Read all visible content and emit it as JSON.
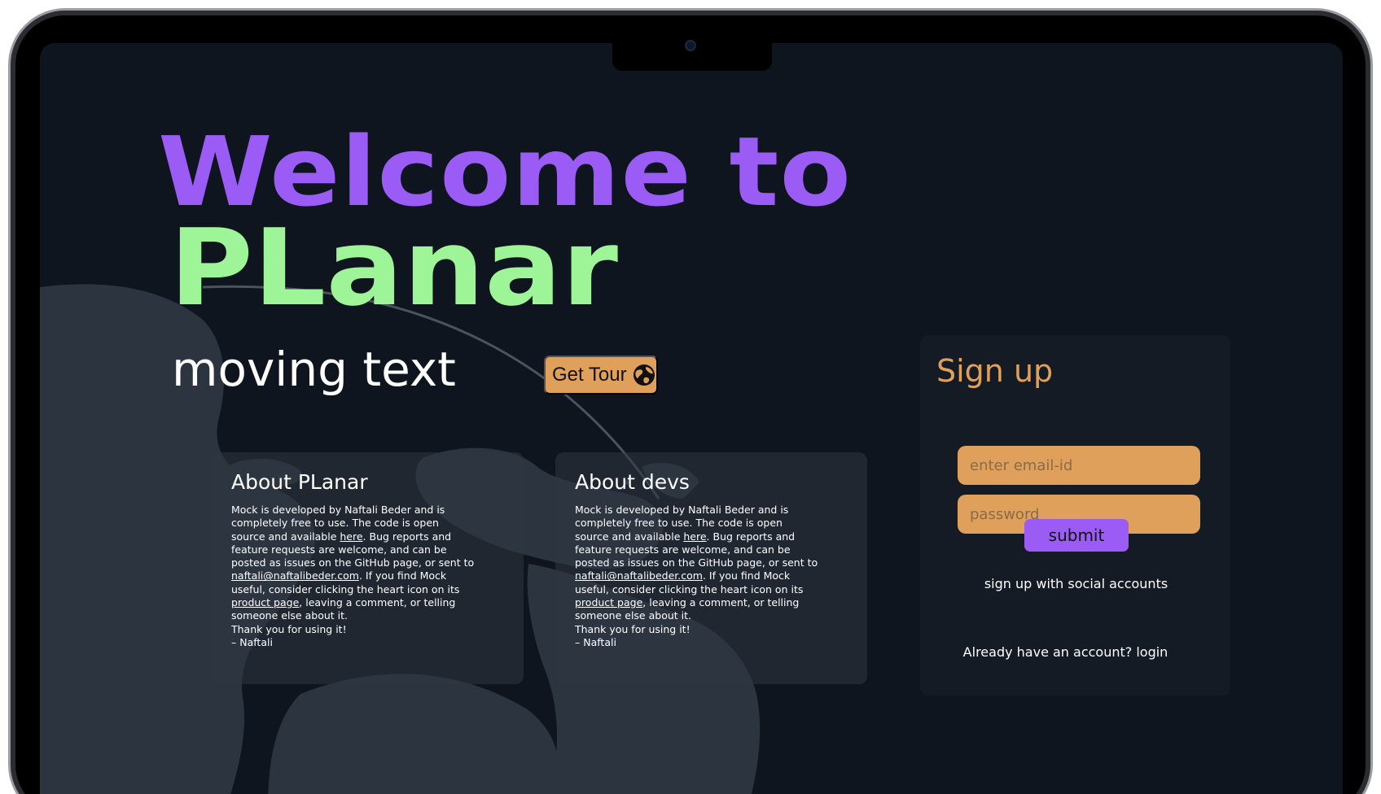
{
  "hero": {
    "title_line1": "Welcome to",
    "title_line2": "PLanar",
    "tagline": "moving text",
    "tour_button": "Get Tour",
    "tour_icon": "globe-icon"
  },
  "cards": [
    {
      "title": "About PLanar",
      "text1": "Mock is developed by Naftali Beder and is completely free to use. The code is open source and available ",
      "link1": "here",
      "text2": ". Bug reports and feature requests are welcome, and can be posted as issues on the GitHub page, or sent to ",
      "email": "naftali@naftalibeder.com",
      "text3": ". If you find Mock useful, consider clicking the heart icon on its ",
      "link2": "product page",
      "text4": ", leaving a comment, or telling someone else about it.",
      "thanks": "Thank you for using it!",
      "sign": "– Naftali"
    },
    {
      "title": "About devs",
      "text1": "Mock is developed by Naftali Beder and is completely free to use. The code is open source and available ",
      "link1": "here",
      "text2": ". Bug reports and feature requests are welcome, and can be posted as issues on the GitHub page, or sent to ",
      "email": "naftali@naftalibeder.com",
      "text3": ". If you find Mock useful, consider clicking the heart icon on its ",
      "link2": "product page",
      "text4": ", leaving a comment, or telling someone else about it.",
      "thanks": "Thank you for using it!",
      "sign": "– Naftali"
    }
  ],
  "signup": {
    "title": "Sign up",
    "email_placeholder": "enter email-id",
    "password_placeholder": "password",
    "submit": "submit",
    "social": "sign up with social accounts",
    "login": "Already have an account? login"
  },
  "colors": {
    "background": "#0f151e",
    "purple": "#9b5cf6",
    "green": "#9ef598",
    "orange": "#dfa05b"
  }
}
